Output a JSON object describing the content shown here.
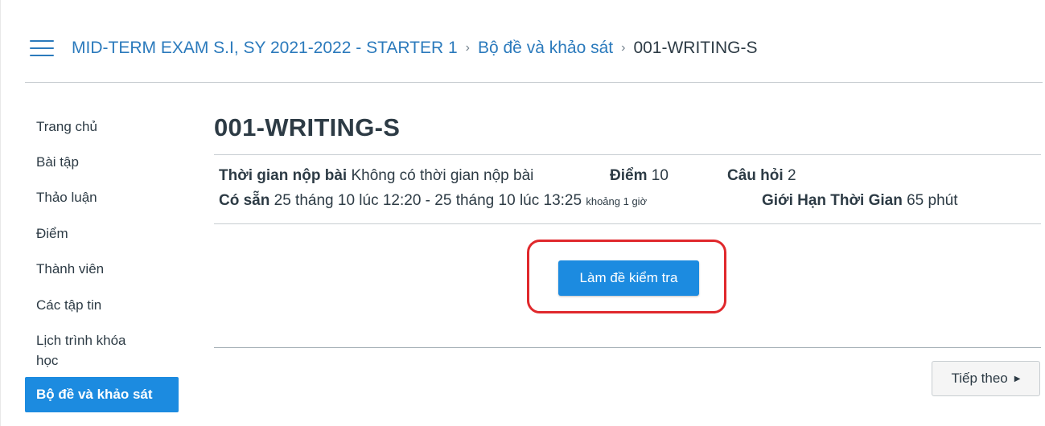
{
  "breadcrumb": {
    "course": "MID-TERM EXAM S.I, SY 2021-2022 - STARTER 1",
    "section": "Bộ đề và khảo sát",
    "current": "001-WRITING-S",
    "separator": "›"
  },
  "sidebar": {
    "items": [
      {
        "label": "Trang chủ",
        "active": false
      },
      {
        "label": "Bài tập",
        "active": false
      },
      {
        "label": "Thảo luận",
        "active": false
      },
      {
        "label": "Điểm",
        "active": false
      },
      {
        "label": "Thành viên",
        "active": false
      },
      {
        "label": "Các tập tin",
        "active": false
      },
      {
        "label": "Lịch trình khóa học",
        "active": false
      },
      {
        "label": "Bộ đề và khảo sát",
        "active": true
      }
    ]
  },
  "quiz": {
    "title": "001-WRITING-S",
    "due_label": "Thời gian nộp bài",
    "due_value": "Không có thời gian nộp bài",
    "points_label": "Điểm",
    "points_value": "10",
    "questions_label": "Câu hỏi",
    "questions_value": "2",
    "available_label": "Có sẵn",
    "available_value": "25 tháng 10 lúc 12:20 - 25 tháng 10 lúc 13:25",
    "available_duration": "khoảng 1 giờ",
    "time_limit_label": "Giới Hạn Thời Gian",
    "time_limit_value": "65 phút",
    "take_quiz_label": "Làm đề kiểm tra",
    "next_label": "Tiếp theo",
    "next_icon": "triangle-right-icon"
  },
  "colors": {
    "accent": "#1c8be0",
    "link": "#2b7abc",
    "highlight_ring": "#e0282c",
    "text": "#2d3b45"
  }
}
